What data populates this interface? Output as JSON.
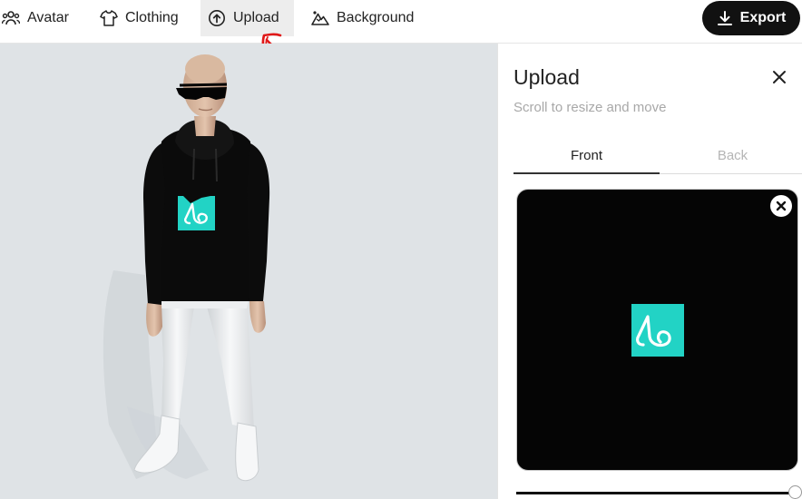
{
  "nav": {
    "items": [
      {
        "label": "Avatar",
        "icon": "avatar-group-icon"
      },
      {
        "label": "Clothing",
        "icon": "tshirt-icon"
      },
      {
        "label": "Upload",
        "icon": "upload-cloud-icon",
        "selected": true
      },
      {
        "label": "Background",
        "icon": "mountain-icon"
      }
    ],
    "export_label": "Export"
  },
  "colors": {
    "accent_dark": "#111111",
    "selected_tab_bg": "#ededed",
    "logo_teal": "#22d3c5",
    "annotation_red": "#e01818"
  },
  "panel": {
    "title": "Upload",
    "hint": "Scroll to resize and move",
    "tabs": [
      {
        "label": "Front",
        "active": true
      },
      {
        "label": "Back",
        "active": false
      }
    ],
    "slider_value": 1.0
  }
}
